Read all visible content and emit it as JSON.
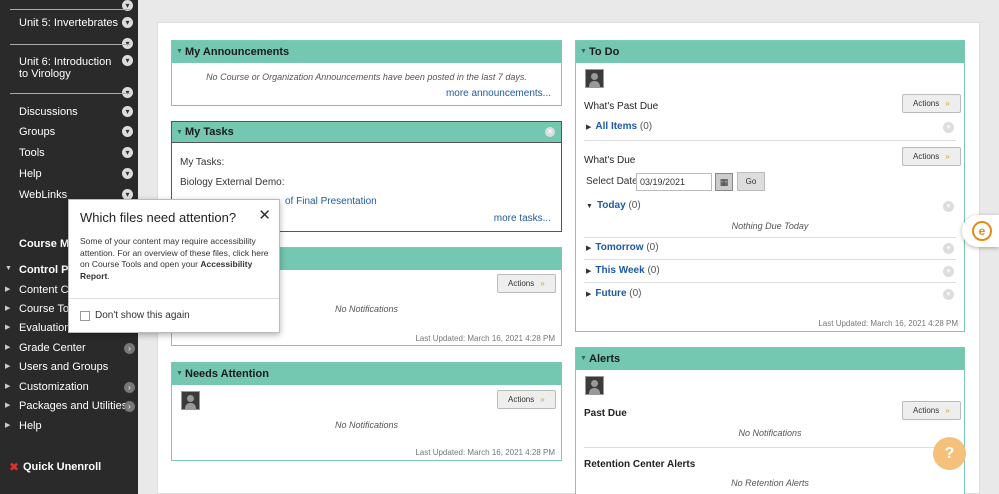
{
  "sidebar": {
    "units": [
      {
        "label": "Unit 5: Invertebrates"
      },
      {
        "label": "Unit 6: Introduction to Virology"
      }
    ],
    "links": [
      {
        "label": "Discussions"
      },
      {
        "label": "Groups"
      },
      {
        "label": "Tools"
      },
      {
        "label": "Help"
      },
      {
        "label": "WebLinks"
      }
    ],
    "course_management_heading": "Course Ma",
    "control_panel_label": "Control Pa",
    "control_items": [
      {
        "label": "Content Colle"
      },
      {
        "label": "Course Tools"
      },
      {
        "label": "Evaluation"
      },
      {
        "label": "Grade Center"
      },
      {
        "label": "Users and Groups"
      },
      {
        "label": "Customization"
      },
      {
        "label": "Packages and Utilities"
      },
      {
        "label": "Help"
      }
    ],
    "quick_unenroll": "Quick Unenroll"
  },
  "announcements": {
    "title": "My Announcements",
    "empty_text": "No Course or Organization Announcements have been posted in the last 7 days.",
    "more_link": "more announcements..."
  },
  "tasks": {
    "title": "My Tasks",
    "line1": "My Tasks:",
    "line2": "Biology External Demo:",
    "task_link": "of Final Presentation",
    "more_link": "more tasks..."
  },
  "notifications_module": {
    "actions_label": "Actions",
    "empty_text": "No Notifications",
    "updated": "Last Updated: March 16, 2021 4:28 PM"
  },
  "needs_attention": {
    "title": "Needs Attention",
    "actions_label": "Actions",
    "empty_text": "No Notifications",
    "updated": "Last Updated: March 16, 2021 4:28 PM"
  },
  "todo": {
    "title": "To Do",
    "past_due_label": "What's Past Due",
    "actions_label": "Actions",
    "all_items": {
      "label": "All Items",
      "count": "(0)"
    },
    "due_label": "What's Due",
    "select_date_label": "Select Date:",
    "date_value": "03/19/2021",
    "go_label": "Go",
    "today": {
      "label": "Today",
      "count": "(0)"
    },
    "nothing_due": "Nothing Due Today",
    "tomorrow": {
      "label": "Tomorrow",
      "count": "(0)"
    },
    "this_week": {
      "label": "This Week",
      "count": "(0)"
    },
    "future": {
      "label": "Future",
      "count": "(0)"
    },
    "updated": "Last Updated: March 16, 2021 4:28 PM"
  },
  "alerts": {
    "title": "Alerts",
    "past_due_label": "Past Due",
    "actions_label": "Actions",
    "empty_text": "No Notifications",
    "retention_label": "Retention Center Alerts",
    "retention_empty": "No Retention Alerts"
  },
  "popup": {
    "title": "Which files need attention?",
    "body_text": "Some of your content may require accessibility attention. For an overview of these files, click here on Course Tools and open your",
    "body_bold": "Accessibility Report",
    "body_end": ".",
    "checkbox_label": "Don't show this again"
  },
  "icons": {
    "chevron": "chevron-down-icon",
    "close": "close-icon",
    "calendar": "calendar-icon",
    "help": "help-icon"
  },
  "colors": {
    "module_header": "#74c7b1",
    "sidebar_bg": "#2a2a2a",
    "link": "#1e5aa0",
    "accent_orange": "#e88a1a"
  }
}
